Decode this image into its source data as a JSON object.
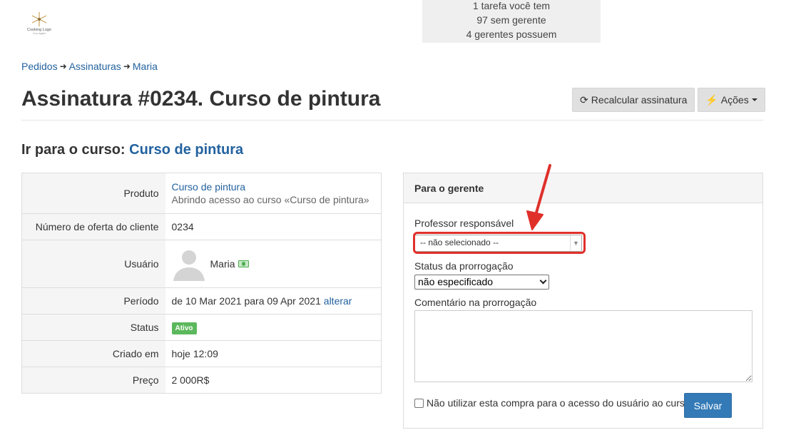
{
  "logo": {
    "text": "Cooking Logo",
    "subtitle": "Your tagline"
  },
  "tasks": [
    "1 tarefa você tem",
    "97 sem gerente",
    "4 gerentes possuem"
  ],
  "breadcrumb": [
    "Pedidos",
    "Assinaturas",
    "Maria"
  ],
  "page": {
    "title": "Assinatura #0234. Curso de pintura",
    "recalc_label": "Recalcular assinatura",
    "actions_label": "Ações",
    "course_prefix": "Ir para o curso:",
    "course_link": "Curso de pintura"
  },
  "details": {
    "product_label": "Produto",
    "product_link": "Curso de pintura",
    "product_sub": "Abrindo acesso ao curso «Curso de pintura»",
    "offer_label": "Número de oferta do cliente",
    "offer_value": "0234",
    "user_label": "Usuário",
    "user_name": "Maria",
    "period_label": "Período",
    "period_value": "de 10 Mar 2021 para 09 Apr 2021",
    "period_change": "alterar",
    "status_label": "Status",
    "status_value": "Ativo",
    "created_label": "Criado em",
    "created_value": "hoje 12:09",
    "price_label": "Preço",
    "price_value": "2 000R$"
  },
  "manager": {
    "header": "Para o gerente",
    "teacher_label": "Professor responsável",
    "teacher_value": "-- não selecionado --",
    "extension_label": "Status da prorrogação",
    "extension_value": "não especificado",
    "comment_label": "Comentário na prorrogação",
    "comment_value": "",
    "checkbox_label": "Não utilizar esta compra para o acesso do usuário ao curso",
    "checkbox_checked": false,
    "save_label": "Salvar"
  },
  "colors": {
    "link": "#23629f",
    "primary_button": "#337ab7",
    "status_badge": "#5cb85c",
    "annotation": "#e0302a"
  }
}
